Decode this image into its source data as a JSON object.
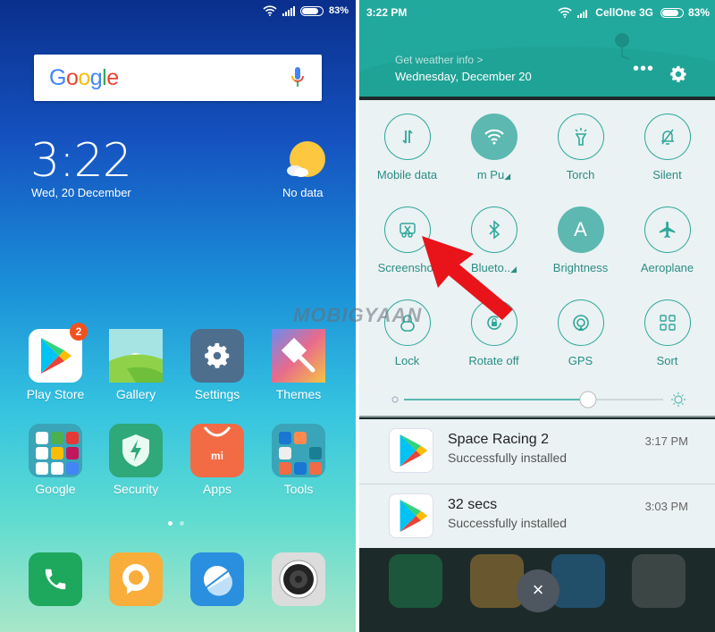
{
  "left": {
    "status": {
      "battery": "83%"
    },
    "search": {
      "logo_letters": [
        {
          "ch": "G",
          "color": "#4285f4"
        },
        {
          "ch": "o",
          "color": "#ea4335"
        },
        {
          "ch": "o",
          "color": "#fbbc05"
        },
        {
          "ch": "g",
          "color": "#4285f4"
        },
        {
          "ch": "l",
          "color": "#34a853"
        },
        {
          "ch": "e",
          "color": "#ea4335"
        }
      ]
    },
    "clock": {
      "time": "3:22",
      "date": "Wed, 20 December"
    },
    "weather": {
      "icon": "sun-cloud-icon",
      "text": "No data"
    },
    "apps": [
      {
        "label": "Play Store",
        "icon": "play-store-icon",
        "badge": "2",
        "bg": "#ffffff"
      },
      {
        "label": "Gallery",
        "icon": "gallery-icon",
        "bg": "#8fd26a"
      },
      {
        "label": "Settings",
        "icon": "gear-icon",
        "bg": "#4e6e8e"
      },
      {
        "label": "Themes",
        "icon": "paintbrush-icon",
        "bg": "#e06c8a"
      },
      {
        "label": "Google",
        "icon": "folder-icon",
        "bg": "#3aa5b8"
      },
      {
        "label": "Security",
        "icon": "shield-bolt-icon",
        "bg": "#2fa87a"
      },
      {
        "label": "Apps",
        "icon": "mi-bag-icon",
        "bg": "#f26b45"
      },
      {
        "label": "Tools",
        "icon": "folder-icon",
        "bg": "#3aa5b8"
      }
    ],
    "page_indicator": {
      "pages": 2,
      "current": 1
    },
    "dock": [
      {
        "name": "phone",
        "icon": "phone-icon",
        "bg": "#1ea85e"
      },
      {
        "name": "messages",
        "icon": "message-icon",
        "bg": "#f9ad3a"
      },
      {
        "name": "browser",
        "icon": "browser-icon",
        "bg": "#2b8fe0"
      },
      {
        "name": "camera",
        "icon": "camera-icon",
        "bg": "#dcdcdc"
      }
    ]
  },
  "right": {
    "status": {
      "time": "3:22 PM",
      "carrier": "CellOne 3G",
      "battery": "83%"
    },
    "header": {
      "weather_link": "Get weather info >",
      "date": "Wednesday, December 20",
      "more": "•••"
    },
    "toggles": [
      {
        "label": "Mobile data",
        "icon": "mobile-data-icon",
        "on": false
      },
      {
        "label": "m    Pu",
        "icon": "wifi-icon",
        "on": true,
        "expand": true
      },
      {
        "label": "Torch",
        "icon": "torch-icon",
        "on": false
      },
      {
        "label": "Silent",
        "icon": "bell-off-icon",
        "on": false
      },
      {
        "label": "Screenshot",
        "icon": "screenshot-icon",
        "on": false
      },
      {
        "label": "Blueto..",
        "icon": "bluetooth-icon",
        "on": false,
        "expand": true
      },
      {
        "label": "Brightness",
        "icon": "brightness-auto-icon",
        "on": true
      },
      {
        "label": "Aeroplane",
        "icon": "airplane-icon",
        "on": false
      },
      {
        "label": "Lock",
        "icon": "lock-icon",
        "on": false
      },
      {
        "label": "Rotate off",
        "icon": "rotate-lock-icon",
        "on": false
      },
      {
        "label": "GPS",
        "icon": "gps-icon",
        "on": false
      },
      {
        "label": "Sort",
        "icon": "grid-icon",
        "on": false
      }
    ],
    "brightness_level": 0.71,
    "notifications": [
      {
        "title": "Space Racing 2",
        "subtitle": "Successfully installed",
        "time": "3:17 PM"
      },
      {
        "title": "32 secs",
        "subtitle": "Successfully installed",
        "time": "3:03 PM"
      }
    ],
    "close_label": "×"
  },
  "watermark": "MOBIGYAAN",
  "colors": {
    "accent": "#2fa79a",
    "header": "#22a99d",
    "annotation_arrow": "#e8141a"
  }
}
